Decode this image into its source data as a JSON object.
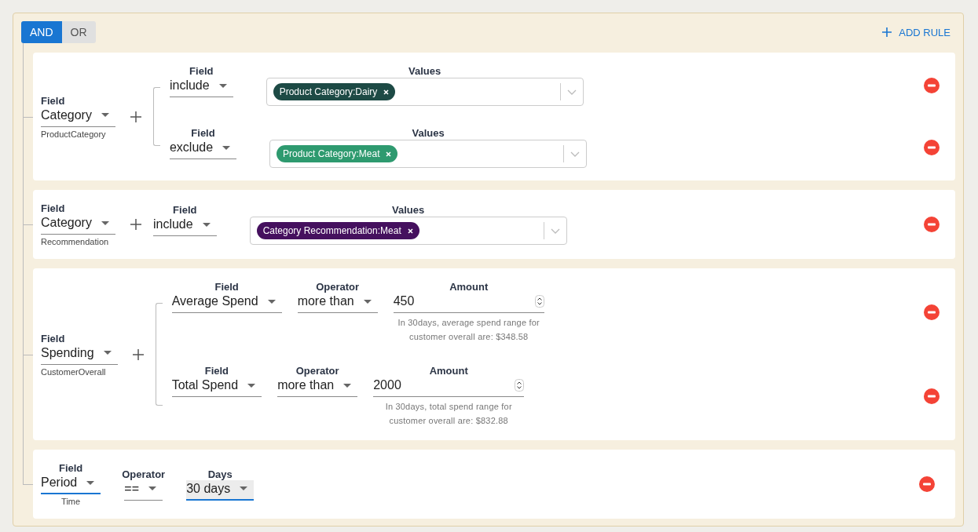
{
  "logic": [
    {
      "label": "AND",
      "selected": true
    },
    {
      "label": "OR",
      "selected": false
    }
  ],
  "add_rule": {
    "label": "ADD RULE"
  },
  "rules": [
    {
      "kind": "group",
      "field": {
        "label": "Field",
        "value": "Category",
        "caption": "ProductCategory"
      },
      "conditions": [
        {
          "kind": "values",
          "field": {
            "label": "Field",
            "value": "include"
          },
          "values_label": "Values",
          "tags": [
            {
              "text": "Product Category:Dairy",
              "color": "#1d4a45"
            }
          ]
        },
        {
          "kind": "values",
          "field": {
            "label": "Field",
            "value": "exclude"
          },
          "values_label": "Values",
          "tags": [
            {
              "text": "Product Category:Meat",
              "color": "#2e9a6f"
            }
          ]
        }
      ]
    },
    {
      "kind": "group",
      "field": {
        "label": "Field",
        "value": "Category",
        "caption": "Recommendation"
      },
      "conditions": [
        {
          "kind": "values",
          "field": {
            "label": "Field",
            "value": "include"
          },
          "values_label": "Values",
          "tags": [
            {
              "text": "Category Recommendation:Meat",
              "color": "#45105e"
            }
          ]
        }
      ]
    },
    {
      "kind": "group",
      "field": {
        "label": "Field",
        "value": "Spending",
        "caption": "CustomerOverall"
      },
      "conditions": [
        {
          "kind": "amount",
          "field": {
            "label": "Field",
            "value": "Average Spend"
          },
          "operator": {
            "label": "Operator",
            "value": "more than"
          },
          "amount": {
            "label": "Amount",
            "value": "450",
            "hint": "In 30days, average spend range for customer overall are: $348.58"
          }
        },
        {
          "kind": "amount",
          "field": {
            "label": "Field",
            "value": "Total Spend"
          },
          "operator": {
            "label": "Operator",
            "value": "more than"
          },
          "amount": {
            "label": "Amount",
            "value": "2000",
            "hint": "In 30days, total spend range for customer overall are: $832.88"
          }
        }
      ]
    },
    {
      "kind": "simple",
      "selects": [
        {
          "label": "Field",
          "value": "Period",
          "caption": "Time",
          "focused": true,
          "highlighted": false
        },
        {
          "label": "Operator",
          "value": "==",
          "focused": false,
          "highlighted": false
        },
        {
          "label": "Days",
          "value": "30 days",
          "focused": true,
          "highlighted": true
        }
      ]
    }
  ]
}
